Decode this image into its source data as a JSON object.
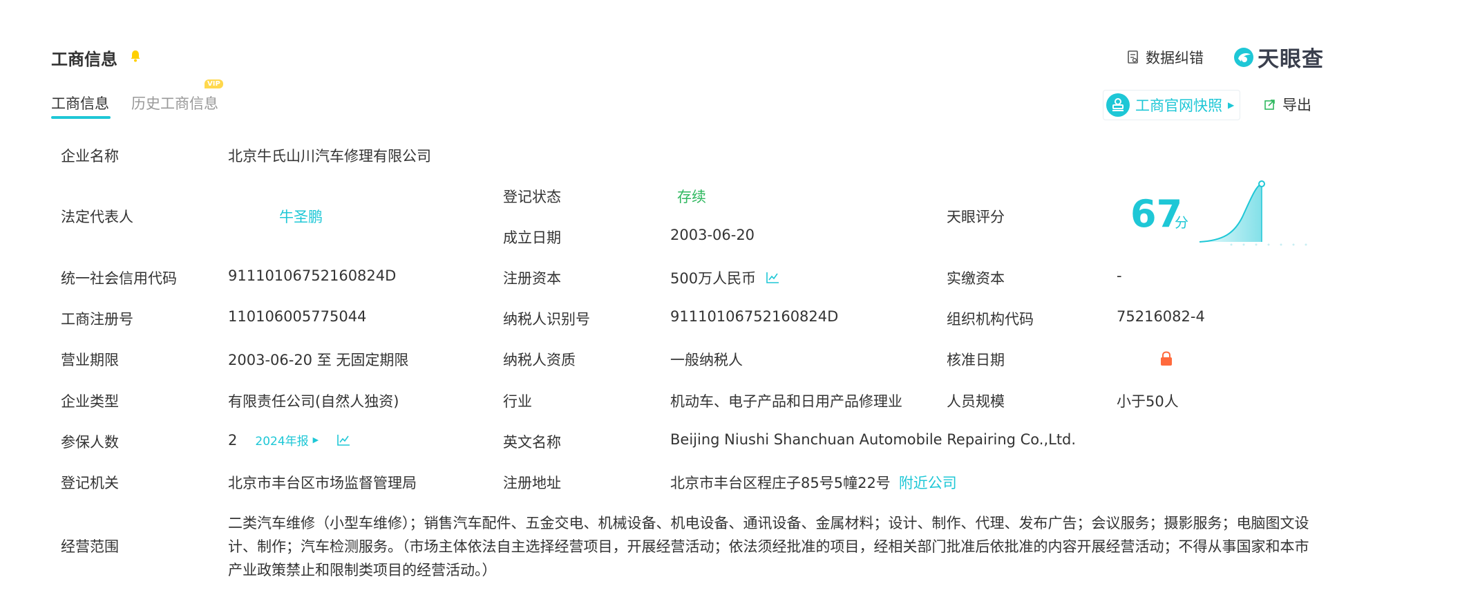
{
  "header": {
    "title": "工商信息",
    "feedback_label": "数据纠错",
    "brand_name": "天眼查"
  },
  "tabs": [
    {
      "label": "工商信息",
      "active": true
    },
    {
      "label": "历史工商信息",
      "active": false,
      "badge": "VIP"
    }
  ],
  "actions": {
    "snapshot_label": "工商官网快照",
    "export_label": "导出"
  },
  "fields": {
    "company_name": {
      "label": "企业名称",
      "value": "北京牛氏山川汽车修理有限公司"
    },
    "legal_rep": {
      "label": "法定代表人",
      "value": "牛圣鹏"
    },
    "reg_status": {
      "label": "登记状态",
      "value": "存续"
    },
    "found_date": {
      "label": "成立日期",
      "value": "2003-06-20"
    },
    "tianyan_score": {
      "label": "天眼评分",
      "value": "67",
      "unit": "分"
    },
    "credit_code": {
      "label": "统一社会信用代码",
      "value": "91110106752160824D"
    },
    "reg_capital": {
      "label": "注册资本",
      "value": "500万人民币"
    },
    "paid_capital": {
      "label": "实缴资本",
      "value": "-"
    },
    "reg_number": {
      "label": "工商注册号",
      "value": "110106005775044"
    },
    "taxpayer_id": {
      "label": "纳税人识别号",
      "value": "91110106752160824D"
    },
    "org_code": {
      "label": "组织机构代码",
      "value": "75216082-4"
    },
    "biz_term": {
      "label": "营业期限",
      "value": "2003-06-20 至 无固定期限"
    },
    "taxpayer_qual": {
      "label": "纳税人资质",
      "value": "一般纳税人"
    },
    "approval_date": {
      "label": "核准日期",
      "value": ""
    },
    "company_type": {
      "label": "企业类型",
      "value": "有限责任公司(自然人独资)"
    },
    "industry": {
      "label": "行业",
      "value": "机动车、电子产品和日用产品修理业"
    },
    "staff_size": {
      "label": "人员规模",
      "value": "小于50人"
    },
    "insured": {
      "label": "参保人数",
      "value": "2",
      "report_link": "2024年报"
    },
    "english_name": {
      "label": "英文名称",
      "value": "Beijing Niushi Shanchuan Automobile Repairing Co.,Ltd."
    },
    "reg_authority": {
      "label": "登记机关",
      "value": "北京市丰台区市场监督管理局"
    },
    "reg_address": {
      "label": "注册地址",
      "value": "北京市丰台区程庄子85号5幢22号",
      "nearby_link": "附近公司"
    },
    "biz_scope": {
      "label": "经营范围",
      "value": "二类汽车维修（小型车维修）；销售汽车配件、五金交电、机械设备、机电设备、通讯设备、金属材料；设计、制作、代理、发布广告；会议服务；摄影服务；电脑图文设计、制作；汽车检测服务。（市场主体依法自主选择经营项目，开展经营活动；依法须经批准的项目，经相关部门批准后依批准的内容开展经营活动；不得从事国家和本市产业政策禁止和限制类项目的经营活动。）"
    }
  },
  "colors": {
    "accent": "#1ec7d6",
    "status_green": "#2fb85f",
    "lock_orange": "#ff6a3d",
    "vip_yellow": "#ffd84d"
  }
}
